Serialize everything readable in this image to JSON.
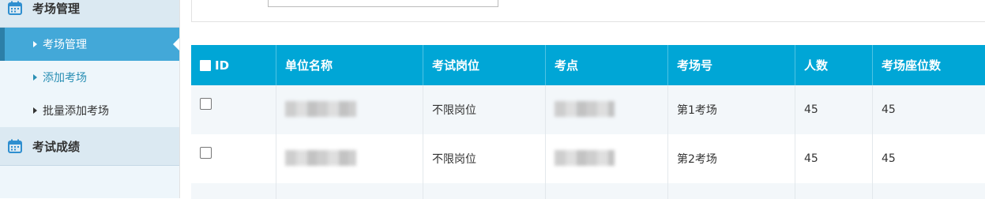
{
  "sidebar": {
    "groups": [
      {
        "label": "考场管理",
        "icon": "calendar-icon"
      },
      {
        "label": "考试成绩",
        "icon": "calendar-icon"
      }
    ],
    "items": [
      {
        "label": "考场管理",
        "state": "active"
      },
      {
        "label": "添加考场",
        "state": "hover"
      },
      {
        "label": "批量添加考场",
        "state": "normal"
      }
    ]
  },
  "colors": {
    "header_bg": "#00a6d6",
    "active_item": "#43a8d8",
    "sidebar_bg": "#eef6fb"
  },
  "table": {
    "columns": [
      "ID",
      "单位名称",
      "考试岗位",
      "考点",
      "考场号",
      "人数",
      "考场座位数"
    ],
    "rows": [
      {
        "unit": "",
        "post": "不限岗位",
        "site": "",
        "room": "第1考场",
        "people": "45",
        "seats": "45"
      },
      {
        "unit": "",
        "post": "不限岗位",
        "site": "",
        "room": "第2考场",
        "people": "45",
        "seats": "45"
      }
    ]
  }
}
